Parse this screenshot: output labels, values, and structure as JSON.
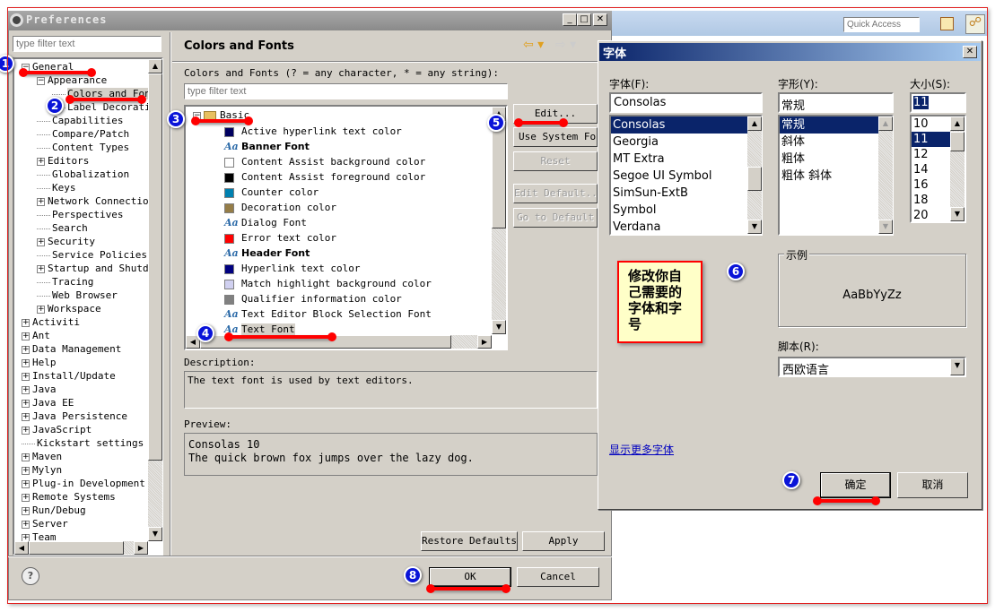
{
  "eclipse": {
    "quick_access_placeholder": "Quick Access"
  },
  "prefs": {
    "title": "Preferences",
    "filter_placeholder": "type filter text",
    "tree": [
      {
        "label": "General",
        "level": 0,
        "exp": "-"
      },
      {
        "label": "Appearance",
        "level": 1,
        "exp": "-"
      },
      {
        "label": "Colors and Fonts",
        "level": 2,
        "exp": "",
        "selected": true
      },
      {
        "label": "Label Decorations",
        "level": 2,
        "exp": ""
      },
      {
        "label": "Capabilities",
        "level": 1,
        "exp": ""
      },
      {
        "label": "Compare/Patch",
        "level": 1,
        "exp": ""
      },
      {
        "label": "Content Types",
        "level": 1,
        "exp": ""
      },
      {
        "label": "Editors",
        "level": 1,
        "exp": "+"
      },
      {
        "label": "Globalization",
        "level": 1,
        "exp": ""
      },
      {
        "label": "Keys",
        "level": 1,
        "exp": ""
      },
      {
        "label": "Network Connections",
        "level": 1,
        "exp": "+"
      },
      {
        "label": "Perspectives",
        "level": 1,
        "exp": ""
      },
      {
        "label": "Search",
        "level": 1,
        "exp": ""
      },
      {
        "label": "Security",
        "level": 1,
        "exp": "+"
      },
      {
        "label": "Service Policies",
        "level": 1,
        "exp": ""
      },
      {
        "label": "Startup and Shutdown",
        "level": 1,
        "exp": "+"
      },
      {
        "label": "Tracing",
        "level": 1,
        "exp": ""
      },
      {
        "label": "Web Browser",
        "level": 1,
        "exp": ""
      },
      {
        "label": "Workspace",
        "level": 1,
        "exp": "+"
      },
      {
        "label": "Activiti",
        "level": 0,
        "exp": "+"
      },
      {
        "label": "Ant",
        "level": 0,
        "exp": "+"
      },
      {
        "label": "Data Management",
        "level": 0,
        "exp": "+"
      },
      {
        "label": "Help",
        "level": 0,
        "exp": "+"
      },
      {
        "label": "Install/Update",
        "level": 0,
        "exp": "+"
      },
      {
        "label": "Java",
        "level": 0,
        "exp": "+"
      },
      {
        "label": "Java EE",
        "level": 0,
        "exp": "+"
      },
      {
        "label": "Java Persistence",
        "level": 0,
        "exp": "+"
      },
      {
        "label": "JavaScript",
        "level": 0,
        "exp": "+"
      },
      {
        "label": "Kickstart settings",
        "level": 0,
        "exp": ""
      },
      {
        "label": "Maven",
        "level": 0,
        "exp": "+"
      },
      {
        "label": "Mylyn",
        "level": 0,
        "exp": "+"
      },
      {
        "label": "Plug-in Development",
        "level": 0,
        "exp": "+"
      },
      {
        "label": "Remote Systems",
        "level": 0,
        "exp": "+"
      },
      {
        "label": "Run/Debug",
        "level": 0,
        "exp": "+"
      },
      {
        "label": "Server",
        "level": 0,
        "exp": "+"
      },
      {
        "label": "Team",
        "level": 0,
        "exp": "+"
      }
    ],
    "page_title": "Colors and Fonts",
    "filter_label": "Colors and Fonts (? = any character, * = any string):",
    "cf_filter_placeholder": "type filter text",
    "category": "Basic",
    "items": [
      {
        "label": "Active hyperlink text color",
        "kind": "color",
        "color": "#000060"
      },
      {
        "label": "Banner Font",
        "kind": "font",
        "bold": true
      },
      {
        "label": "Content Assist background color",
        "kind": "color",
        "color": "#ffffff"
      },
      {
        "label": "Content Assist foreground color",
        "kind": "color",
        "color": "#000000"
      },
      {
        "label": "Counter color",
        "kind": "color",
        "color": "#0080b0"
      },
      {
        "label": "Decoration color",
        "kind": "color",
        "color": "#957d47"
      },
      {
        "label": "Dialog Font",
        "kind": "font"
      },
      {
        "label": "Error text color",
        "kind": "color",
        "color": "#ff0000"
      },
      {
        "label": "Header Font",
        "kind": "font",
        "bold": true
      },
      {
        "label": "Hyperlink text color",
        "kind": "color",
        "color": "#000080"
      },
      {
        "label": "Match highlight background color",
        "kind": "color",
        "color": "#d0d0f0"
      },
      {
        "label": "Qualifier information color",
        "kind": "color",
        "color": "#808080"
      },
      {
        "label": "Text Editor Block Selection Font",
        "kind": "font"
      },
      {
        "label": "Text Font",
        "kind": "font",
        "selected": true
      }
    ],
    "buttons": {
      "edit": "Edit...",
      "use_system": "Use System Font",
      "reset": "Reset",
      "edit_default": "Edit Default...",
      "go_default": "Go to Default",
      "restore": "Restore Defaults",
      "apply": "Apply",
      "ok": "OK",
      "cancel": "Cancel"
    },
    "description_label": "Description:",
    "description": "The text font is used by text editors.",
    "preview_label": "Preview:",
    "preview_line1": "Consolas 10",
    "preview_line2": "The quick brown fox jumps over the lazy dog."
  },
  "font_dialog": {
    "title": "字体",
    "font_label": "字体(F):",
    "font_value": "Consolas",
    "fonts": [
      "Consolas",
      "Georgia",
      "MT Extra",
      "Segoe UI Symbol",
      "SimSun-ExtB",
      "Symbol",
      "Verdana"
    ],
    "style_label": "字形(Y):",
    "style_value": "常规",
    "styles": [
      "常规",
      "斜体",
      "粗体",
      "粗体 斜体"
    ],
    "size_label": "大小(S):",
    "size_value": "11",
    "sizes": [
      "10",
      "11",
      "12",
      "14",
      "16",
      "18",
      "20"
    ],
    "sample_label": "示例",
    "sample_text": "AaBbYyZz",
    "script_label": "脚本(R):",
    "script_value": "西欧语言",
    "more_fonts": "显示更多字体",
    "ok": "确定",
    "cancel": "取消"
  },
  "annotation": {
    "note": "修改你自己需要的字体和字号",
    "badges": [
      "1",
      "2",
      "3",
      "4",
      "5",
      "6",
      "7",
      "8"
    ],
    "accent": "#ff0000",
    "badge_color": "#0a14d8"
  }
}
